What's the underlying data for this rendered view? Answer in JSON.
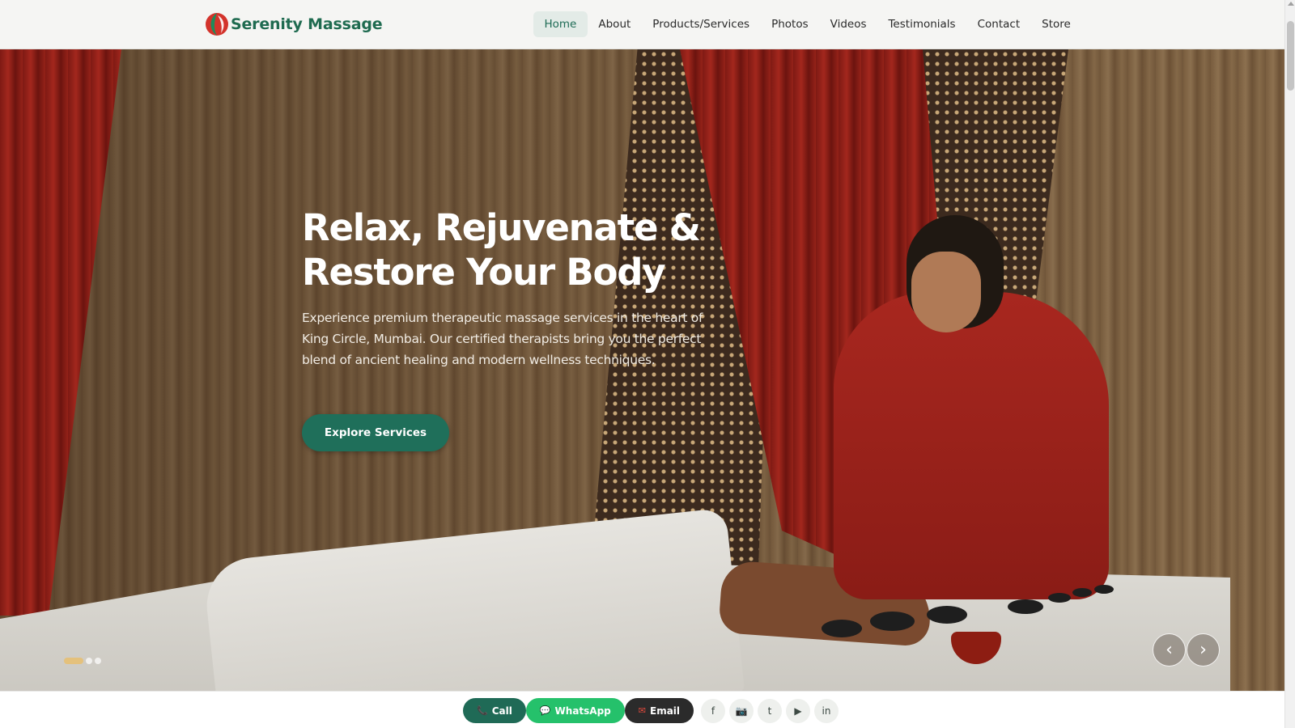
{
  "brand": {
    "name": "Serenity Massage",
    "logo_icon": "leaf-swirl-icon",
    "colors": {
      "primary": "#1f6b50",
      "accent_red": "#d3332b"
    }
  },
  "nav": {
    "items": [
      {
        "label": "Home",
        "active": true
      },
      {
        "label": "About"
      },
      {
        "label": "Products/Services"
      },
      {
        "label": "Photos"
      },
      {
        "label": "Videos"
      },
      {
        "label": "Testimonials"
      },
      {
        "label": "Contact"
      },
      {
        "label": "Store"
      }
    ]
  },
  "hero": {
    "title_line1": "Relax, Rejuvenate &",
    "title_line2": "Restore Your Body",
    "description": "Experience premium therapeutic massage services in the heart of King Circle, Mumbai. Our certified therapists bring you the perfect blend of ancient healing and modern wellness techniques.",
    "cta_label": "Explore Services",
    "slide_count": 3,
    "active_slide": 1,
    "prev_glyph": "‹",
    "next_glyph": "›"
  },
  "contact_bar": {
    "call_label": "Call",
    "whatsapp_label": "WhatsApp",
    "email_label": "Email",
    "social": [
      {
        "icon": "facebook-icon",
        "glyph": "f"
      },
      {
        "icon": "instagram-icon",
        "glyph": "📷"
      },
      {
        "icon": "twitter-icon",
        "glyph": "t"
      },
      {
        "icon": "youtube-icon",
        "glyph": "▶"
      },
      {
        "icon": "linkedin-icon",
        "glyph": "in"
      }
    ],
    "colors": {
      "call": "#1f6a56",
      "whatsapp": "#25c16b",
      "email": "#2b2b2b"
    }
  }
}
